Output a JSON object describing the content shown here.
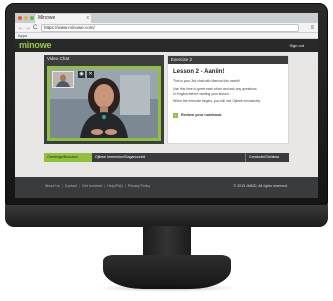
{
  "browser": {
    "tab_title": "Minowe",
    "tab_close": "x",
    "url": "https://www.minowe.com/",
    "back": "←",
    "forward": "→",
    "reload": "C",
    "menu": "≡",
    "bookmark": "Apps"
  },
  "site": {
    "logo": "minowe",
    "sign_out": "Sign out"
  },
  "video_panel": {
    "title": "Video Chat",
    "controls": [
      "◉",
      "✕"
    ]
  },
  "exercise": {
    "panel_title": "Exercise 2",
    "lesson_title": "Lesson 2 - Aaniin!",
    "lines": [
      "This is your 3rd chat with Marcus this month!",
      "Use this time to greet each other and ask any questions",
      "in English before starting your lesson.",
      "When the exercise begins, you will use Ojibwe exclusively."
    ],
    "notebook_icon": "+",
    "notebook_label": "Review your notebook"
  },
  "progress": {
    "segments": [
      "Greetings/Boozhoo",
      "Ojibwe Immersion/Gaganoonidi",
      "Conclude/Gichitwa"
    ]
  },
  "footer": {
    "links": [
      "About Us",
      "Contact",
      "Get Involved",
      "Help/FAQ",
      "Privacy Policy"
    ],
    "separator": "|",
    "copyright": "© 2015 JMMD, All rights reserved."
  },
  "colors": {
    "accent_green": "#8fc13f",
    "header_dark": "#27292a",
    "panel_dark": "#3c3d3e"
  }
}
